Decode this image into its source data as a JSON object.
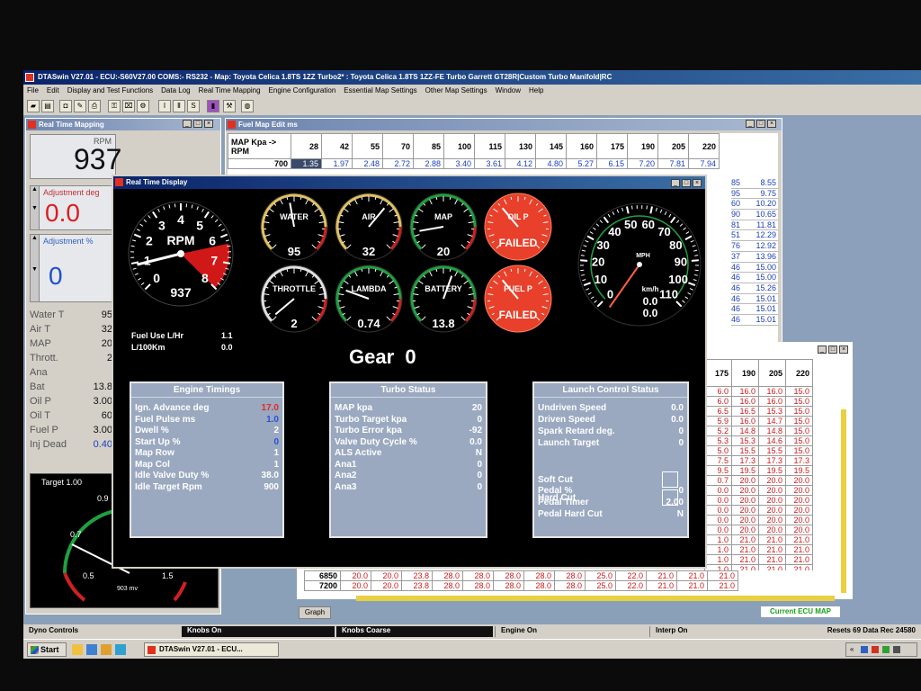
{
  "app": {
    "title": "DTASwin V27.01 - ECU:-S60V27.00 COMS:- RS232 - Map: Toyota Celica 1.8TS 1ZZ Turbo2* : Toyota Celica 1.8TS 1ZZ-FE Turbo Garrett GT28R|Custom Turbo Manifold|RC",
    "menu": [
      "File",
      "Edit",
      "Display and Test Functions",
      "Data Log",
      "Real Time Mapping",
      "Engine Configuration",
      "Essential Map Settings",
      "Other Map Settings",
      "Window",
      "Help"
    ]
  },
  "rtm": {
    "title": "Real Time Mapping",
    "rpm_value": "937",
    "rpm_label": "RPM",
    "adj_deg_label": "Adjustment deg",
    "adj_deg_value": "0.0",
    "adj_pct_label": "Adjustment %",
    "adj_pct_value": "0",
    "sensors": [
      {
        "label": "Water T",
        "value": "95"
      },
      {
        "label": "Air T",
        "value": "32"
      },
      {
        "label": "MAP",
        "value": "20"
      },
      {
        "label": "Thrott.",
        "value": "2"
      },
      {
        "label": "Ana",
        "value": ""
      },
      {
        "label": "Bat",
        "value": "13.8"
      },
      {
        "label": "Oil P",
        "value": "3.00"
      },
      {
        "label": "Oil T",
        "value": "60"
      },
      {
        "label": "Fuel P",
        "value": "3.00"
      },
      {
        "label": "Inj Dead",
        "value": "0.40"
      }
    ],
    "target_label": "Target 1.00",
    "gauge_ticks": [
      "0.9",
      "0.7",
      "0.5",
      "1.5"
    ],
    "gauge_unit": "903 mv"
  },
  "fuelmap": {
    "title": "Fuel Map Edit ms",
    "corner": "MAP Kpa -> RPM",
    "headers": [
      "28",
      "42",
      "55",
      "70",
      "85",
      "100",
      "115",
      "130",
      "145",
      "160",
      "175",
      "190",
      "205",
      "220"
    ],
    "row700": [
      "700",
      "1.35",
      "1.97",
      "2.48",
      "2.72",
      "2.88",
      "3.40",
      "3.61",
      "4.12",
      "4.80",
      "5.27",
      "6.15",
      "7.20",
      "7.81",
      "7.94"
    ],
    "right_col_pairs": [
      [
        "85",
        "8.55"
      ],
      [
        "95",
        "9.75"
      ],
      [
        "60",
        "10.20"
      ],
      [
        "90",
        "10.65"
      ],
      [
        "81",
        "11.81"
      ],
      [
        "51",
        "12.29"
      ],
      [
        "76",
        "12.92"
      ],
      [
        "37",
        "13.96"
      ],
      [
        "46",
        "15.00"
      ],
      [
        "46",
        "15.00"
      ],
      [
        "46",
        "15.26"
      ],
      [
        "46",
        "15.01"
      ],
      [
        "46",
        "15.01"
      ],
      [
        "46",
        "15.01"
      ]
    ]
  },
  "igmap": {
    "headers": [
      "175",
      "190",
      "205",
      "220"
    ],
    "rows": [
      [
        "6.0",
        "16.0",
        "16.0",
        "15.0"
      ],
      [
        "6.0",
        "16.0",
        "16.0",
        "15.0"
      ],
      [
        "6.5",
        "16.5",
        "15.3",
        "15.0"
      ],
      [
        "5.9",
        "16.0",
        "14.7",
        "15.0"
      ],
      [
        "5.2",
        "14.8",
        "14.8",
        "15.0"
      ],
      [
        "5.3",
        "15.3",
        "14.6",
        "15.0"
      ],
      [
        "5.0",
        "15.5",
        "15.5",
        "15.0"
      ],
      [
        "7.5",
        "17.3",
        "17.3",
        "17.3"
      ],
      [
        "9.5",
        "19.5",
        "19.5",
        "19.5"
      ],
      [
        "0.7",
        "20.0",
        "20.0",
        "20.0"
      ],
      [
        "0.0",
        "20.0",
        "20.0",
        "20.0"
      ],
      [
        "0.0",
        "20.0",
        "20.0",
        "20.0"
      ],
      [
        "0.0",
        "20.0",
        "20.0",
        "20.0"
      ],
      [
        "0.0",
        "20.0",
        "20.0",
        "20.0"
      ],
      [
        "0.0",
        "20.0",
        "20.0",
        "20.0"
      ],
      [
        "1.0",
        "21.0",
        "21.0",
        "21.0"
      ],
      [
        "1.0",
        "21.0",
        "21.0",
        "21.0"
      ],
      [
        "1.0",
        "21.0",
        "21.0",
        "21.0"
      ],
      [
        "1.0",
        "21.0",
        "21.0",
        "21.0"
      ]
    ],
    "bottom_rows": [
      [
        "6850",
        "20.0",
        "20.0",
        "23.8",
        "28.0",
        "28.0",
        "28.0",
        "28.0",
        "28.0",
        "25.0",
        "22.0",
        "21.0",
        "21.0",
        "21.0"
      ],
      [
        "7200",
        "20.0",
        "20.0",
        "23.8",
        "28.0",
        "28.0",
        "28.0",
        "28.0",
        "28.0",
        "25.0",
        "22.0",
        "21.0",
        "21.0",
        "21.0"
      ]
    ],
    "graph_btn": "Graph",
    "current_label": "Current ECU MAP"
  },
  "rtd": {
    "title": "Real Time Display",
    "rpm_gauge": {
      "label": "RPM",
      "value": "937",
      "ticks": [
        "0",
        "1",
        "2",
        "3",
        "4",
        "5",
        "6",
        "7",
        "8"
      ]
    },
    "small_gauges": [
      {
        "name": "WATER",
        "value": "95",
        "failed": false
      },
      {
        "name": "AIR",
        "value": "32",
        "failed": false
      },
      {
        "name": "MAP",
        "value": "20",
        "failed": false
      },
      {
        "name": "OIL P",
        "value": "FAILED",
        "failed": true
      },
      {
        "name": "THROTTLE",
        "value": "2",
        "failed": false
      },
      {
        "name": "LAMBDA",
        "value": "0.74",
        "failed": false
      },
      {
        "name": "BATTERY",
        "value": "13.8",
        "failed": false
      },
      {
        "name": "FUEL P",
        "value": "FAILED",
        "failed": true
      }
    ],
    "speedo": {
      "unit1": "MPH",
      "unit2": "km/h",
      "v1": "0.0",
      "v2": "0.0",
      "ticks": [
        "0",
        "10",
        "20",
        "30",
        "40",
        "50",
        "60",
        "70",
        "80",
        "90",
        "100",
        "110"
      ]
    },
    "fuel_use_label": "Fuel Use L/Hr",
    "fuel_use_value": "1.1",
    "l100_label": "L/100Km",
    "l100_value": "0.0",
    "gear_text": "Gear  0",
    "engine_timings": {
      "title": "Engine Timings",
      "rows": [
        {
          "l": "Ign. Advance deg",
          "v": "17.0",
          "c": "red"
        },
        {
          "l": "Fuel Pulse ms",
          "v": "1.0",
          "c": "blue"
        },
        {
          "l": "Dwell %",
          "v": "2",
          "c": ""
        },
        {
          "l": "Start Up %",
          "v": "0",
          "c": "blue"
        },
        {
          "l": "Map Row",
          "v": "1",
          "c": ""
        },
        {
          "l": "Map Col",
          "v": "1",
          "c": ""
        },
        {
          "l": "Idle Valve Duty %",
          "v": "38.0",
          "c": ""
        },
        {
          "l": "Idle Target Rpm",
          "v": "900",
          "c": ""
        }
      ]
    },
    "turbo_status": {
      "title": "Turbo Status",
      "rows": [
        {
          "l": "MAP kpa",
          "v": "20"
        },
        {
          "l": "Turbo Target kpa",
          "v": "0"
        },
        {
          "l": "Turbo Error kpa",
          "v": "-92"
        },
        {
          "l": "Valve Duty Cycle %",
          "v": "0.0"
        },
        {
          "l": "ALS Active",
          "v": "N"
        },
        {
          "l": "Ana1",
          "v": "0"
        },
        {
          "l": "Ana2",
          "v": "0"
        },
        {
          "l": "Ana3",
          "v": "0"
        }
      ]
    },
    "launch_control": {
      "title": "Launch Control Status",
      "rows": [
        {
          "l": "Undriven Speed",
          "v": "0.0"
        },
        {
          "l": "Driven Speed",
          "v": "0.0"
        },
        {
          "l": "Spark Retard deg.",
          "v": "0"
        },
        {
          "l": "Launch Target",
          "v": "0"
        },
        {
          "l": "Soft Cut",
          "v": ""
        },
        {
          "l": "Hard Cut",
          "v": ""
        },
        {
          "l": "Pedal %",
          "v": "0"
        },
        {
          "l": "Pedal Timer",
          "v": "2.00"
        },
        {
          "l": "Pedal Hard Cut",
          "v": "N"
        }
      ]
    }
  },
  "statusbar": {
    "dyno": "Dyno Controls",
    "knobs_on": "Knobs On",
    "knobs_coarse": "Knobs Coarse",
    "engine_on": "Engine On",
    "interp_on": "Interp On",
    "resets": "Resets 69 Data Rec 24580"
  },
  "taskbar": {
    "start": "Start",
    "task": "DTASwin V27.01 - ECU..."
  }
}
